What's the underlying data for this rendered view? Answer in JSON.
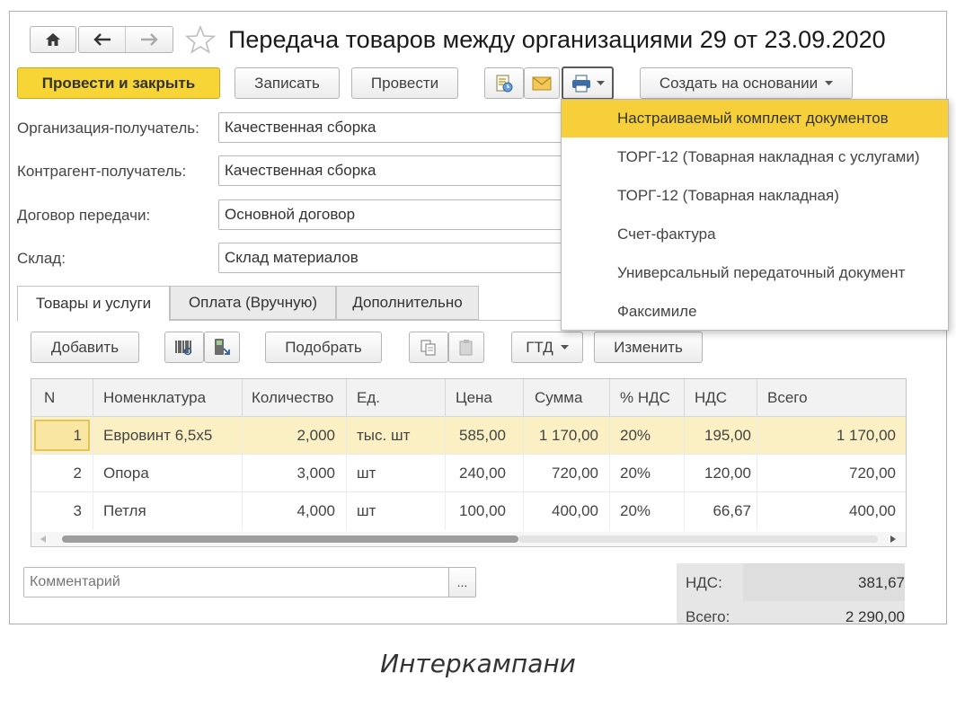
{
  "header": {
    "title": "Передача товаров между организациями 29 от 23.09.2020"
  },
  "toolbar": {
    "post_close_label": "Провести и закрыть",
    "save_label": "Записать",
    "post_label": "Провести",
    "create_based_label": "Создать на основании"
  },
  "form": {
    "org_label": "Организация-получатель:",
    "org_value": "Качественная сборка",
    "counterparty_label": "Контрагент-получатель:",
    "counterparty_value": "Качественная сборка",
    "contract_label": "Договор передачи:",
    "contract_value": "Основной договор",
    "warehouse_label": "Склад:",
    "warehouse_value": "Склад материалов"
  },
  "print_menu": {
    "items": [
      "Настраиваемый комплект документов",
      "ТОРГ-12 (Товарная накладная с услугами)",
      "ТОРГ-12 (Товарная накладная)",
      "Счет-фактура",
      "Универсальный передаточный документ",
      "Факсимиле"
    ]
  },
  "tabs": [
    "Товары и услуги",
    "Оплата (Вручную)",
    "Дополнительно"
  ],
  "table_toolbar": {
    "add_label": "Добавить",
    "pick_label": "Подобрать",
    "gtd_label": "ГТД",
    "change_label": "Изменить"
  },
  "table": {
    "columns": [
      "N",
      "Номенклатура",
      "Количество",
      "Ед.",
      "Цена",
      "Сумма",
      "% НДС",
      "НДС",
      "Всего"
    ],
    "rows": [
      [
        "1",
        "Евровинт 6,5х5",
        "2,000",
        "тыс. шт",
        "585,00",
        "1 170,00",
        "20%",
        "195,00",
        "1 170,00"
      ],
      [
        "2",
        "Опора",
        "3,000",
        "шт",
        "240,00",
        "720,00",
        "20%",
        "120,00",
        "720,00"
      ],
      [
        "3",
        "Петля",
        "4,000",
        "шт",
        "100,00",
        "400,00",
        "20%",
        "66,67",
        "400,00"
      ]
    ]
  },
  "comment": {
    "placeholder": "Комментарий",
    "more_label": "..."
  },
  "totals": {
    "vat_label": "НДС:",
    "vat_value": "381,67",
    "total_label": "Всего:",
    "total_value": "2 290,00"
  },
  "caption": "Интеркампани",
  "colors": {
    "accent_yellow": "#f7d537",
    "menu_highlight": "#f6cf3a",
    "selected_row": "#fbf0c4"
  }
}
